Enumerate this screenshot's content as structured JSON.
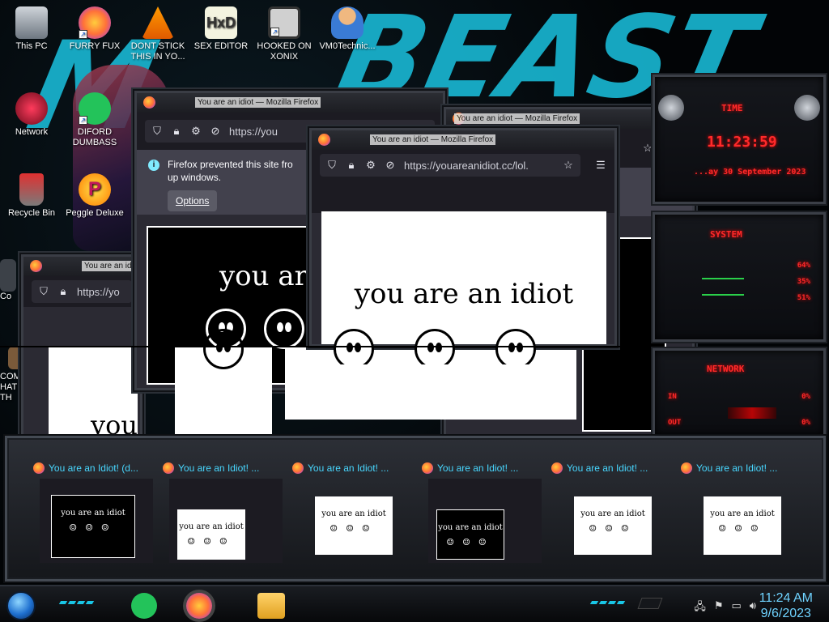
{
  "desktop": {
    "icons": [
      {
        "label": "This PC",
        "color": "#9aa3ad"
      },
      {
        "label": "FURRY FUX",
        "color": "#ff7139"
      },
      {
        "label": "DONT STICK THIS IN YO...",
        "color": "#f08a00"
      },
      {
        "label": "SEX EDITOR",
        "color": "#c8d400"
      },
      {
        "label": "HOOKED ON XONIX",
        "color": "#c81e1e"
      },
      {
        "label": "VM0Technic...",
        "color": "#e8b27a"
      },
      {
        "label": "Network",
        "color": "#c81e32"
      },
      {
        "label": "DIFORD DUMBASS",
        "color": "#23c35a"
      },
      {
        "label": "Recycle Bin",
        "color": "#c81e1e"
      },
      {
        "label": "Peggle Deluxe",
        "color": "#ff8a00"
      },
      {
        "label": "Co",
        "color": "#3c4148"
      },
      {
        "label": "COMMU HATE TH",
        "color": "#7a5a3a"
      }
    ]
  },
  "windows": [
    {
      "title": "You are an idiot — Mozilla Firefox",
      "url": "https://yo",
      "page_text": "you are an idiot"
    },
    {
      "title": "You are an idiot — Mozilla Firefox",
      "url": "https://you",
      "notification": "Firefox prevented this site from opening 3 pop-up windows.",
      "notification_visible": "Firefox prevented this site fro up windows.",
      "options_label": "Options",
      "page_text": "you are a"
    },
    {
      "title": "You are an idiot — Mozilla Firefox",
      "url": "",
      "close_label": "✕"
    },
    {
      "title": "You are an idiot — Mozilla Firefox",
      "url": "https://youareanidiot.cc/lol.",
      "page_text": "you are an idiot"
    }
  ],
  "behind_text": {
    "left": "you a",
    "t": "t"
  },
  "gadgets": {
    "time_label": "TIME",
    "time": "11:23:59",
    "date": "...ay 30 September 2023",
    "system_label": "SYSTEM",
    "cpu1": "64%",
    "cpu2": "35%",
    "cpu3": "51%",
    "network_label": "NETWORK",
    "in_label": "IN",
    "in_value": "0%",
    "out_label": "OUT",
    "out_value": "0%"
  },
  "thumbnails": [
    {
      "label": "You are an Idiot! (d...",
      "page_text": "you are an idiot",
      "theme": "black"
    },
    {
      "label": "You are an Idiot! ...",
      "page_text": "you are an idiot",
      "theme": "white"
    },
    {
      "label": "You are an Idiot! ...",
      "page_text": "you are an idiot",
      "theme": "white"
    },
    {
      "label": "You are an Idiot! ...",
      "page_text": "you are an idiot",
      "theme": "black"
    },
    {
      "label": "You are an Idiot! ...",
      "page_text": "you are an idiot",
      "theme": "white"
    },
    {
      "label": "You are an Idiot! ...",
      "page_text": "you are an idiot",
      "theme": "white"
    }
  ],
  "taskbar": {
    "time": "11:24 AM",
    "date": "9/6/2023"
  }
}
